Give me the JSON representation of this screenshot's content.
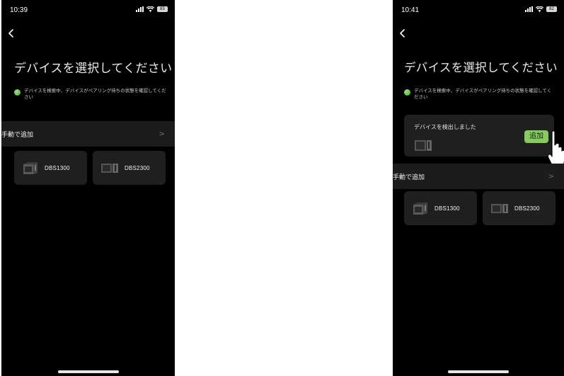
{
  "left_screen": {
    "status": {
      "time": "10:39",
      "battery": "83"
    },
    "title": "デバイスを選択してください",
    "hint": "デバイスを検索中、デバイスがペアリング待ちの状態を確認してください",
    "manual_add": {
      "label": "手動で追加",
      "chevron": ">"
    },
    "models": [
      {
        "label": "DBS1300"
      },
      {
        "label": "DBS2300"
      }
    ]
  },
  "right_screen": {
    "status": {
      "time": "10:41",
      "battery": "82"
    },
    "title": "デバイスを選択してください",
    "hint": "デバイスを検索中、デバイスがペアリング待ちの状態を確認してください",
    "detected": {
      "title": "デバイスを検出しました",
      "add_label": "追加"
    },
    "manual_add": {
      "label": "手動で追加",
      "chevron": ">"
    },
    "models": [
      {
        "label": "DBS1300"
      },
      {
        "label": "DBS2300"
      }
    ]
  },
  "colors": {
    "background": "#000000",
    "card": "#1f1f1f",
    "row": "#1c1c1c",
    "accent_green": "#8ac961",
    "status_dot": "#5fbf54"
  },
  "icons": [
    "back-icon",
    "signal-icon",
    "wifi-icon",
    "battery-icon",
    "green-dot-icon",
    "chevron-right-icon",
    "power-station-icon",
    "cursor-hand-icon"
  ]
}
